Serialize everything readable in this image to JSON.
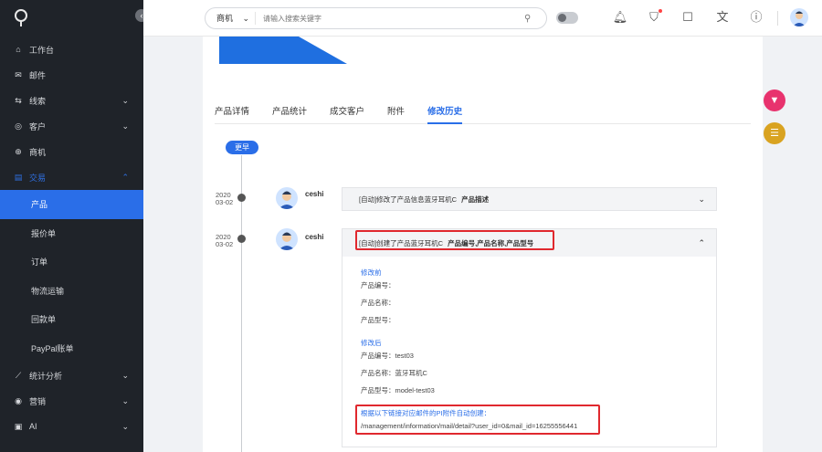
{
  "sidebar": {
    "items": [
      {
        "label": "工作台",
        "icon": "home-icon"
      },
      {
        "label": "邮件",
        "icon": "mail-icon"
      },
      {
        "label": "线索",
        "icon": "leads-icon"
      },
      {
        "label": "客户",
        "icon": "customer-icon"
      },
      {
        "label": "商机",
        "icon": "opportunity-icon"
      },
      {
        "label": "交易",
        "icon": "transaction-icon"
      }
    ],
    "sub_items": [
      "产品",
      "报价单",
      "订单",
      "物流运输",
      "回款单",
      "PayPal账单"
    ],
    "bottom_items": [
      {
        "label": "统计分析",
        "icon": "chart-icon"
      },
      {
        "label": "营销",
        "icon": "marketing-icon"
      },
      {
        "label": "AI",
        "icon": "ai-icon"
      }
    ]
  },
  "topbar": {
    "search_select": "商机",
    "search_placeholder": "请输入搜索关键字"
  },
  "tabs": [
    "产品详情",
    "产品统计",
    "成交客户",
    "附件",
    "修改历史"
  ],
  "timeline": {
    "earlier_label": "更早",
    "entries": [
      {
        "date_year": "2020",
        "date_md": "03-02",
        "user": "ceshi",
        "summary": "[自动]修改了产品信息蓝牙耳机C",
        "fields": "产品描述"
      },
      {
        "date_year": "2020",
        "date_md": "03-02",
        "user": "ceshi",
        "summary": "[自动]创建了产品蓝牙耳机C",
        "fields": "产品编号,产品名称,产品型号",
        "before_title": "修改前",
        "before": [
          "产品编号：",
          "产品名称：",
          "产品型号："
        ],
        "after_title": "修改后",
        "after": [
          "产品编号：test03",
          "产品名称：蓝牙耳机C",
          "产品型号：model-test03"
        ],
        "link_title": "根据以下链接对应邮件的PI附件自动创建：",
        "link": "/management/information/mail/detail?user_id=0&mail_id=16255556441"
      }
    ]
  },
  "colors": {
    "accent": "#2a6ee8",
    "sidebar_bg": "#1f2329",
    "highlight_red": "#e0282e",
    "filter_btn": "#e8336e",
    "list_btn": "#d9a321"
  }
}
